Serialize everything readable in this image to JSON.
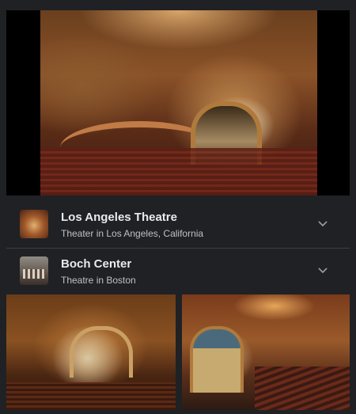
{
  "results": [
    {
      "title": "Los Angeles Theatre",
      "subtitle": "Theater in Los Angeles, California",
      "thumbnail": "los-angeles-theatre-thumbnail",
      "icon": "chevron-down-icon"
    },
    {
      "title": "Boch Center",
      "subtitle": "Theatre in Boston",
      "thumbnail": "boch-center-thumbnail",
      "icon": "chevron-down-icon"
    }
  ],
  "colors": {
    "background": "#202124",
    "title": "#e8eaed",
    "subtitle": "#bdc1c6",
    "divider": "#3c4043",
    "chevron": "#9aa0a6"
  }
}
